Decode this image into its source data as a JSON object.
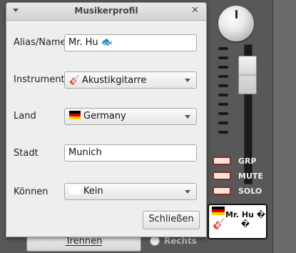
{
  "dialog": {
    "title": "Musikerprofil",
    "fields": {
      "alias": {
        "label": "Alias/Name",
        "value": "Mr. Hu 🐟"
      },
      "instrument": {
        "label": "Instrument",
        "value": "Akustikgitarre",
        "icon": "guitar-icon"
      },
      "country": {
        "label": "Land",
        "value": "Germany",
        "icon": "germany-flag-icon"
      },
      "city": {
        "label": "Stadt",
        "value": "Munich"
      },
      "skill": {
        "label": "Können",
        "value": "Kein"
      }
    },
    "close_label": "Schließen"
  },
  "mixer": {
    "buttons": {
      "grp": "GRP",
      "mute": "MUTE",
      "solo": "SOLO"
    },
    "card_name": "Mr. Hu � �",
    "disconnect_label": "Trennen",
    "pan_right_label": "Rechts",
    "led_color": "#8a2a2a"
  }
}
